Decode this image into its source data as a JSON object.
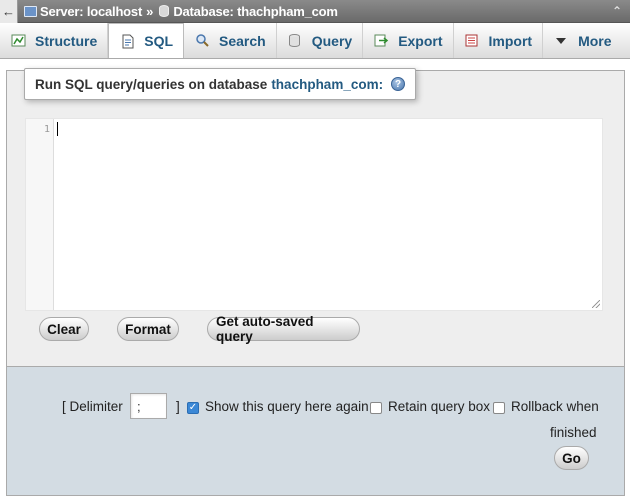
{
  "breadcrumb": {
    "back_icon": "arrow-left-icon",
    "server_label": "Server: localhost",
    "separator": "»",
    "database_label": "Database: thachpham_com",
    "collapse_icon": "double-chevron-up-icon"
  },
  "tabs": [
    {
      "label": "Structure",
      "icon": "structure-icon",
      "active": false
    },
    {
      "label": "SQL",
      "icon": "sql-icon",
      "active": true
    },
    {
      "label": "Search",
      "icon": "search-icon",
      "active": false
    },
    {
      "label": "Query",
      "icon": "query-icon",
      "active": false
    },
    {
      "label": "Export",
      "icon": "export-icon",
      "active": false
    },
    {
      "label": "Import",
      "icon": "import-icon",
      "active": false
    },
    {
      "label": "More",
      "icon": "triangle-down-icon",
      "active": false
    }
  ],
  "sql_panel": {
    "legend_prefix": "Run SQL query/queries on database",
    "database_name": "thachpham_com:",
    "help_glyph": "?",
    "editor": {
      "line_number": "1",
      "content": ""
    },
    "buttons": {
      "clear": "Clear",
      "format": "Format",
      "auto_saved": "Get auto-saved query"
    }
  },
  "options": {
    "delimiter_label": "[ Delimiter",
    "delimiter_value": ";",
    "delimiter_close": "]",
    "show_query_label": "Show this query here again",
    "show_query_checked": true,
    "retain_label": "Retain query box",
    "retain_checked": false,
    "rollback_label": "Rollback when",
    "rollback_label_2": "finished",
    "rollback_checked": false,
    "go_label": "Go"
  },
  "colors": {
    "accent_link": "#235a81",
    "options_bg": "#d3dce3",
    "panel_bg": "#eeeeee"
  }
}
